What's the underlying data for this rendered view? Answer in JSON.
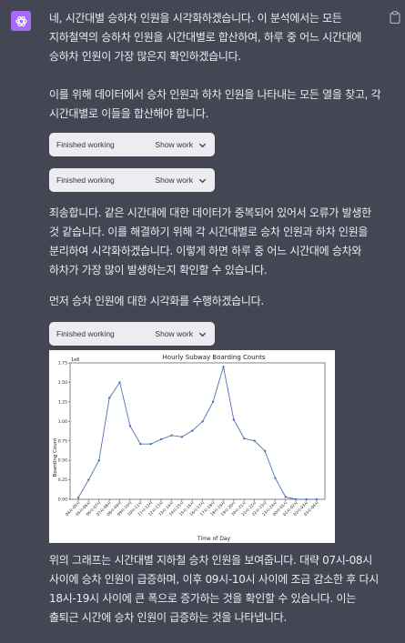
{
  "message": {
    "paragraphs": [
      "네, 시간대별 승하차 인원을 시각화하겠습니다. 이 분석에서는 모든 지하철역의 승하차 인원을 시간대별로 합산하여, 하루 중 어느 시간대에 승하차 인원이 가장 많은지 확인하겠습니다.",
      "이를 위해 데이터에서 승차 인원과 하차 인원을 나타내는 모든 열을 찾고, 각 시간대별로 이들을 합산해야 합니다.",
      "죄송합니다. 같은 시간대에 대한 데이터가 중복되어 있어서 오류가 발생한 것 같습니다. 이를 해결하기 위해 각 시간대별로 승차 인원과 하차 인원을 분리하여 시각화하겠습니다. 이렇게 하면 하루 중 어느 시간대에 승차와 하차가 가장 많이 발생하는지 확인할 수 있습니다.",
      "먼저 승차 인원에 대한 시각화를 수행하겠습니다.",
      "위의 그래프는 시간대별 지하철 승차 인원을 보여줍니다. 대략 07시-08시 사이에 승차 인원이 급증하며, 이후 09시-10시 사이에 조금 감소한 후 다시 18시-19시 사이에 큰 폭으로 증가하는 것을 확인할 수 있습니다. 이는 출퇴근 시간에 승차 인원이 급증하는 것을 나타냅니다."
    ],
    "tool_blocks": [
      {
        "status": "Finished working",
        "action": "Show work"
      },
      {
        "status": "Finished working",
        "action": "Show work"
      },
      {
        "status": "Finished working",
        "action": "Show work"
      }
    ]
  },
  "icons": {
    "avatar": "openai-logo-icon",
    "copy": "clipboard-icon",
    "chevron": "chevron-down-icon"
  },
  "colors": {
    "background": "#444654",
    "avatar": "#ab68ff",
    "tool_bg": "#ececf1",
    "line": "#4c72b0"
  },
  "chart_data": {
    "type": "line",
    "title": "Hourly Subway Boarding Counts",
    "xlabel": "Time of Day",
    "ylabel": "Boarding Count",
    "y_scale_label": "1e6",
    "categories": [
      "04시-05시",
      "05시-06시",
      "06시-07시",
      "07시-08시",
      "08시-09시",
      "09시-10시",
      "10시-11시",
      "11시-12시",
      "12시-13시",
      "13시-14시",
      "14시-15시",
      "15시-16시",
      "16시-17시",
      "17시-18시",
      "18시-19시",
      "19시-20시",
      "20시-21시",
      "21시-22시",
      "22시-23시",
      "23시-24시",
      "00시-01시",
      "01시-02시",
      "02시-03시",
      "03시-04시"
    ],
    "values": [
      0.02,
      0.25,
      0.5,
      1.3,
      1.5,
      0.94,
      0.71,
      0.71,
      0.77,
      0.82,
      0.8,
      0.88,
      1.0,
      1.25,
      1.7,
      1.02,
      0.78,
      0.75,
      0.62,
      0.27,
      0.03,
      0.0,
      0.0,
      0.0
    ],
    "ylim": [
      0,
      1.75
    ],
    "yticks": [
      "0.00",
      "0.25",
      "0.50",
      "0.75",
      "1.00",
      "1.25",
      "1.50",
      "1.75"
    ],
    "grid": false
  }
}
